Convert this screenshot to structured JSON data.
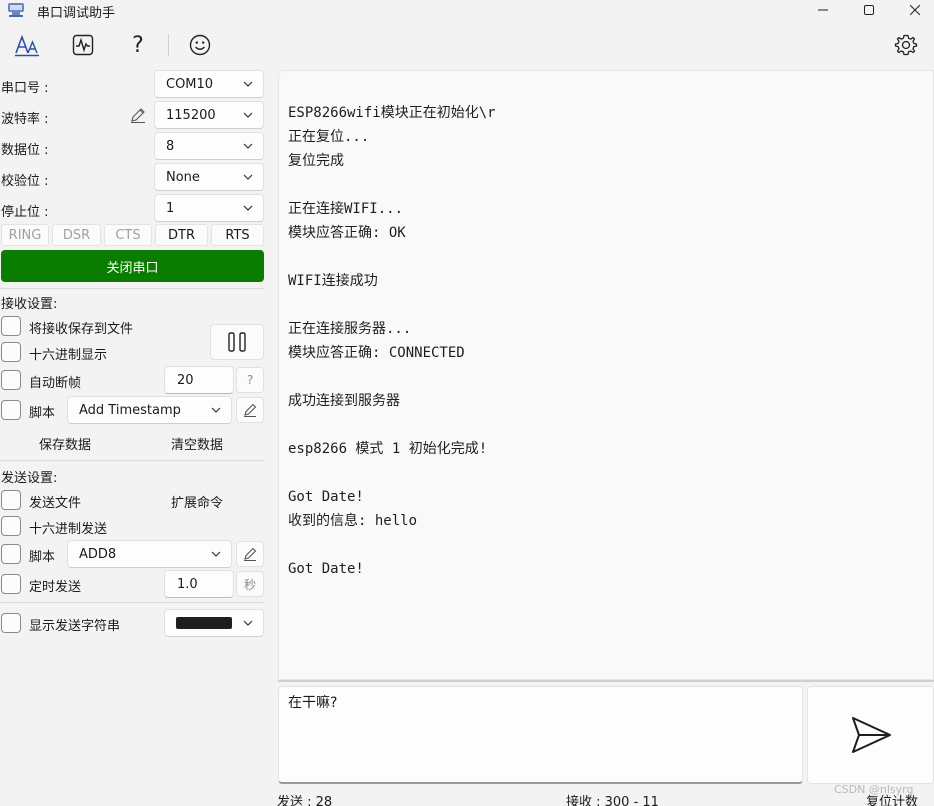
{
  "window": {
    "title": "串口调试助手"
  },
  "toolbar": {
    "icons": [
      "font-icon",
      "waveform-icon",
      "help-icon",
      "smiley-icon",
      "gear-icon"
    ],
    "help_glyph": "?"
  },
  "serial": {
    "port_label": "串口号 :",
    "port_value": "COM10",
    "baud_label": "波特率 :",
    "baud_value": "115200",
    "databits_label": "数据位 :",
    "databits_value": "8",
    "parity_label": "校验位 :",
    "parity_value": "None",
    "stopbits_label": "停止位 :",
    "stopbits_value": "1",
    "signals": [
      "RING",
      "DSR",
      "CTS",
      "DTR",
      "RTS"
    ],
    "toggle_label": "关闭串口"
  },
  "receive_settings": {
    "title": "接收设置:",
    "save_to_file": "将接收保存到文件",
    "hex_display": "十六进制显示",
    "auto_frame": "自动断帧",
    "auto_frame_value": "20",
    "auto_frame_help": "?",
    "script_label": "脚本",
    "script_value": "Add Timestamp",
    "save_data": "保存数据",
    "clear_data": "清空数据"
  },
  "send_settings": {
    "title": "发送设置:",
    "send_file": "发送文件",
    "extend_cmd": "扩展命令",
    "hex_send": "十六进制发送",
    "script_label": "脚本",
    "script_value": "ADD8",
    "timed_send": "定时发送",
    "timed_value": "1.0",
    "timed_unit": "秒",
    "show_send": "显示发送字符串"
  },
  "receive_text": [
    "ESP8266wifi模块正在初始化\\r",
    "正在复位...",
    "复位完成",
    "",
    "正在连接WIFI...",
    "模块应答正确: OK",
    "",
    "WIFI连接成功",
    "",
    "正在连接服务器...",
    "模块应答正确: CONNECTED",
    "",
    "成功连接到服务器",
    "",
    "esp8266 模式 1 初始化完成!",
    "",
    "Got Date!",
    "收到的信息: hello",
    "",
    "Got Date!"
  ],
  "send_text": "在干嘛?",
  "status": {
    "sent": "发送 : 28",
    "received": "接收 : 300  -  11",
    "reset": "复位计数"
  },
  "watermark": "CSDN @nlsyrg",
  "colors": {
    "open_button": "#0a7d00",
    "send_color_swatch": "#1e1e1e"
  }
}
